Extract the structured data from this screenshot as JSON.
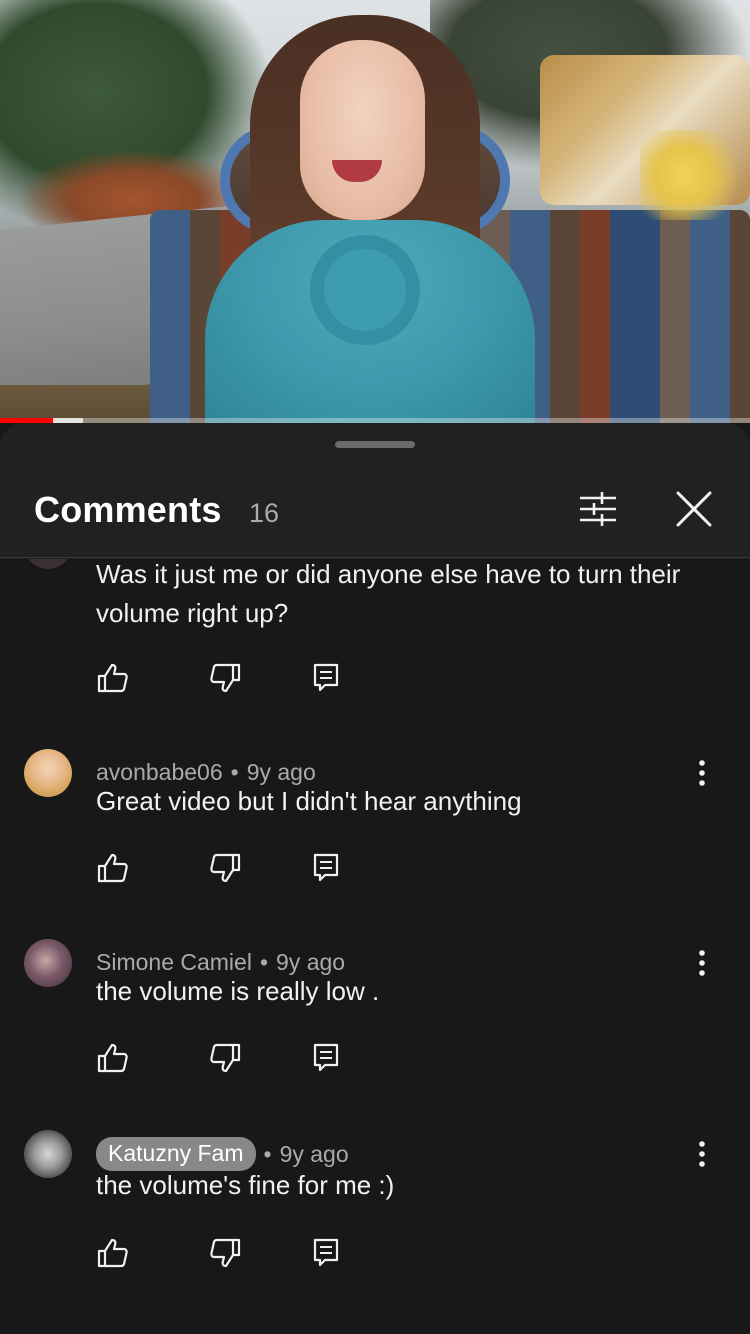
{
  "video": {
    "progress_percent": 7,
    "buffered_percent": 11,
    "colors": {
      "progress": "#ff0000"
    }
  },
  "comments_panel": {
    "title": "Comments",
    "count": "16",
    "filter_icon": "sliders-icon",
    "close_icon": "close-icon"
  },
  "comments": [
    {
      "author": "",
      "time": "",
      "text": "Was it just me or did anyone else have to turn their volume right up?"
    },
    {
      "author": "avonbabe06",
      "time": "9y ago",
      "text": "Great video but I didn't hear anything"
    },
    {
      "author": "Simone Camiel",
      "time": "9y ago",
      "text": "the volume is really low ."
    },
    {
      "author": "Katuzny Fam",
      "time": "9y ago",
      "text": "the volume's fine for me :)",
      "author_highlighted": true
    }
  ],
  "separator": "•",
  "action_icons": [
    "thumbs-up-icon",
    "thumbs-down-icon",
    "reply-icon"
  ]
}
